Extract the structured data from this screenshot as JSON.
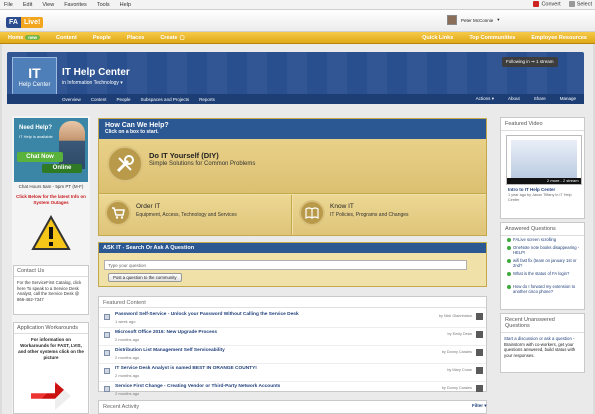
{
  "browser_menu": {
    "items": [
      "File",
      "Edit",
      "View",
      "Favorites",
      "Tools",
      "Help"
    ],
    "convert": "Convert",
    "select": "Select"
  },
  "site": {
    "logo_left": "FA",
    "logo_right": "Live!",
    "user": "Peter McConnie"
  },
  "nav": {
    "left": [
      "Home",
      "Content",
      "People",
      "Places",
      "Create"
    ],
    "home_badge": "new",
    "right": [
      "Quick Links",
      "Top Communities",
      "Employee Resources"
    ]
  },
  "hub": {
    "icon_line1": "IT",
    "icon_line2": "Help Center",
    "title": "IT Help Center",
    "subtitle": "in Information Technology",
    "follow": "Following in ⇝ 1 stream",
    "tabs_left": [
      "Overview",
      "Content",
      "People",
      "Subspaces and Projects",
      "Reports"
    ],
    "tabs_right": [
      "Actions",
      "About",
      "Share",
      "Manage"
    ]
  },
  "left": {
    "needhelp_title": "Need Help?",
    "needhelp_sub": "IT Help is available",
    "chat": "Chat Now",
    "online": "Online",
    "hours": "Chat Hours 5am - 5pm PT (M-F)",
    "click_below": "Click Below for the latest Info on System Outages",
    "contact_title": "Contact Us",
    "contact_body": "For the ServiceFirst Catalog, click here To speak to a Service Desk Analyst, call the Service Desk @ 866-462-7347",
    "apps_title": "Application Workarounds",
    "apps_body": "For information on Workarounds for FAST, LVIS, and other systems click on the picture"
  },
  "howcan": {
    "title": "How Can We Help?",
    "subtitle": "Click on a box to start.",
    "diy_title": "Do IT Yourself (DIY)",
    "diy_sub": "Simple Solutions for Common Problems",
    "order_title": "Order IT",
    "order_sub": "Equipment, Access, Technology and Services",
    "know_title": "Know IT",
    "know_sub": "IT Policies, Programs and Changes"
  },
  "askit": {
    "title": "ASK IT - Search Or Ask A Question",
    "placeholder": "Type your question",
    "post_button": "Post a question to the community"
  },
  "featured": {
    "title": "Featured Content",
    "items": [
      {
        "title": "Password Self-Service - Unlock your Password Without Calling the Service Desk",
        "ago": "1 week ago",
        "by": "by Nick Glannbaton"
      },
      {
        "title": "Microsoft Office 2016: New Upgrade Process",
        "ago": "2 months ago",
        "by": "by Emily Dean"
      },
      {
        "title": "Distribution List Management Self Serviceability",
        "ago": "2 months ago",
        "by": "by Donny Carales"
      },
      {
        "title": "IT Service Desk Analyst is named BEST IN  ORANGE COUNTY!",
        "ago": "2 months ago",
        "by": "by Mary Cruse"
      },
      {
        "title": "Service First Change - Creating Vendor or Third-Party Network Accounts",
        "ago": "2 months ago",
        "by": "by Donny Carales"
      }
    ]
  },
  "recent": {
    "title": "Recent Activity",
    "filter": "Filter"
  },
  "video": {
    "title": "Featured Video",
    "duration": "2 more - 2 stream",
    "name": "Intro to IT Help Center",
    "meta": "1 year ago by Jason Tiffany in IT Help Center"
  },
  "answered": {
    "title": "Answered Questions",
    "items": [
      "FALive screen scrolling",
      "OneNote note books disappearing - HELP!",
      "wifi fast fix (team on january 1st or 2nd?",
      "What is the status of FA login?",
      "How do I forward my extension to another cisco phone?"
    ]
  },
  "unanswered": {
    "title": "Recent Unanswered Questions",
    "link": "Start a discussion or ask a question",
    "body": " - Brainstorm with co-workers, get your questions answered, build status with your responses."
  },
  "colors": {
    "nav": "#e8b42a",
    "banner": "#294f8f",
    "howcan_header": "#2b5892",
    "panel_gold": "#f0e1a8",
    "accent_green": "#58b23b"
  }
}
